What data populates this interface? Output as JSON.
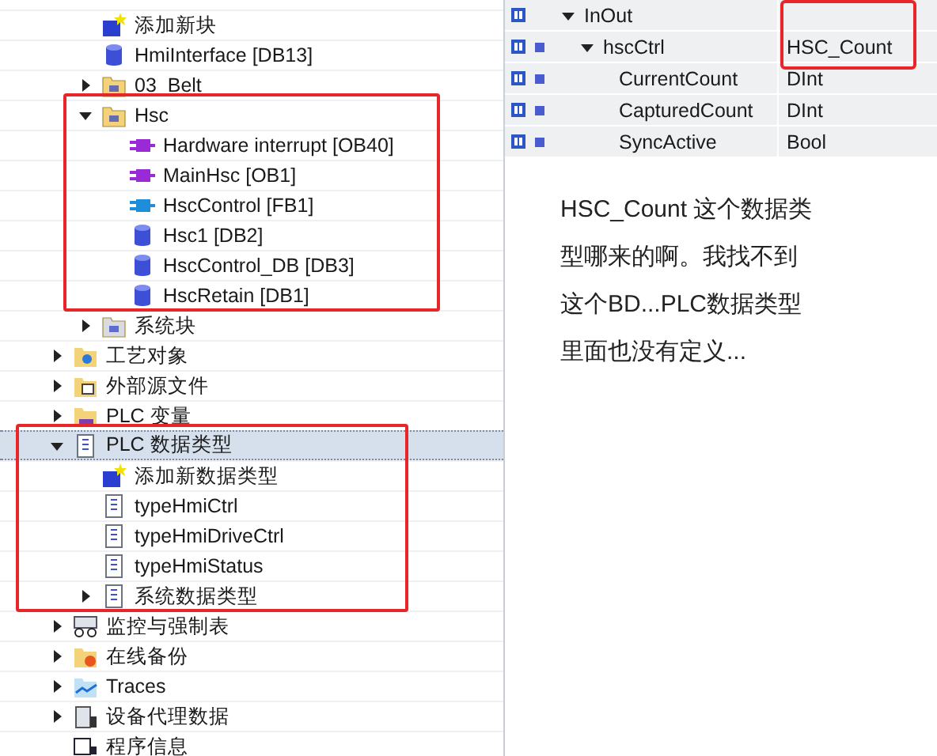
{
  "tree": [
    {
      "children": [
        {
          "label": "添加新块",
          "kind": "add"
        },
        {
          "label": "HmiInterface [DB13]",
          "kind": "db"
        },
        {
          "label": "03_Belt",
          "kind": "folder",
          "expanded": false
        },
        {
          "label": "Hsc",
          "kind": "folder",
          "expanded": true,
          "highlighted": true,
          "children": [
            {
              "label": "Hardware interrupt [OB40]",
              "kind": "ob"
            },
            {
              "label": "MainHsc [OB1]",
              "kind": "ob"
            },
            {
              "label": "HscControl [FB1]",
              "kind": "fb"
            },
            {
              "label": "Hsc1 [DB2]",
              "kind": "db"
            },
            {
              "label": "HscControl_DB [DB3]",
              "kind": "db"
            },
            {
              "label": "HscRetain [DB1]",
              "kind": "db"
            }
          ]
        },
        {
          "label": "系统块",
          "kind": "sysfolder",
          "expanded": false
        }
      ]
    },
    {
      "label": "工艺对象",
      "kind": "techobj",
      "expanded": false
    },
    {
      "label": "外部源文件",
      "kind": "extsrc",
      "expanded": false
    },
    {
      "label": "PLC 变量",
      "kind": "tags",
      "expanded": false
    },
    {
      "label": "PLC 数据类型",
      "kind": "udtfolder",
      "expanded": true,
      "selected": true,
      "highlighted": true,
      "children": [
        {
          "label": "添加新数据类型",
          "kind": "add"
        },
        {
          "label": "typeHmiCtrl",
          "kind": "udt"
        },
        {
          "label": "typeHmiDriveCtrl",
          "kind": "udt"
        },
        {
          "label": "typeHmiStatus",
          "kind": "udt"
        },
        {
          "label": "系统数据类型",
          "kind": "sysudt",
          "expanded": false
        }
      ]
    },
    {
      "label": "监控与强制表",
      "kind": "watch",
      "expanded": false
    },
    {
      "label": "在线备份",
      "kind": "backup",
      "expanded": false
    },
    {
      "label": "Traces",
      "kind": "traces",
      "expanded": false
    },
    {
      "label": "设备代理数据",
      "kind": "proxy",
      "expanded": false
    },
    {
      "label": "程序信息",
      "kind": "info"
    }
  ],
  "interface": [
    {
      "name": "InOut",
      "expanded": true,
      "highlighted": true,
      "children": [
        {
          "name": "hscCtrl",
          "type": "HSC_Count",
          "expanded": true,
          "children": [
            {
              "name": "CurrentCount",
              "type": "DInt"
            },
            {
              "name": "CapturedCount",
              "type": "DInt"
            },
            {
              "name": "SyncActive",
              "type": "Bool"
            }
          ]
        }
      ]
    }
  ],
  "comment": "HSC_Count 这个数据类型哪来的啊。我找不到这个BD...PLC数据类型里面也没有定义..."
}
